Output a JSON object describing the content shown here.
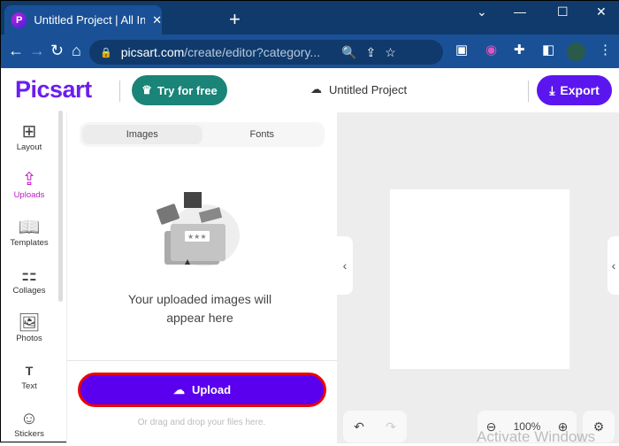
{
  "browser": {
    "tab_title": "Untitled Project | All In One Web",
    "url_host": "picsart.com",
    "url_path": "/create/editor?category...",
    "favicon": "P"
  },
  "header": {
    "logo": "Picsart",
    "try_label": "Try for free",
    "project_name": "Untitled Project",
    "export_label": "Export"
  },
  "rail": {
    "items": [
      {
        "label": "Layout",
        "icon": "⊞"
      },
      {
        "label": "Uploads",
        "icon": "⇪"
      },
      {
        "label": "Templates",
        "icon": "📖"
      },
      {
        "label": "Collages",
        "icon": "⚏"
      },
      {
        "label": "Photos",
        "icon": "🖼"
      },
      {
        "label": "Text",
        "icon": "T"
      },
      {
        "label": "Stickers",
        "icon": "☺"
      }
    ],
    "active": "Uploads"
  },
  "panel": {
    "tabs": [
      "Images",
      "Fonts"
    ],
    "active_tab": "Images",
    "empty_line1": "Your uploaded images will",
    "empty_line2": "appear here",
    "upload_label": "Upload",
    "drag_hint": "Or drag and drop your files here."
  },
  "canvas": {
    "zoom": "100%"
  },
  "watermark": "Activate Windows",
  "colors": {
    "brand": "#6b1ef0",
    "upload": "#5b00ee",
    "try": "#1a8478",
    "active_rail": "#c018c8"
  }
}
